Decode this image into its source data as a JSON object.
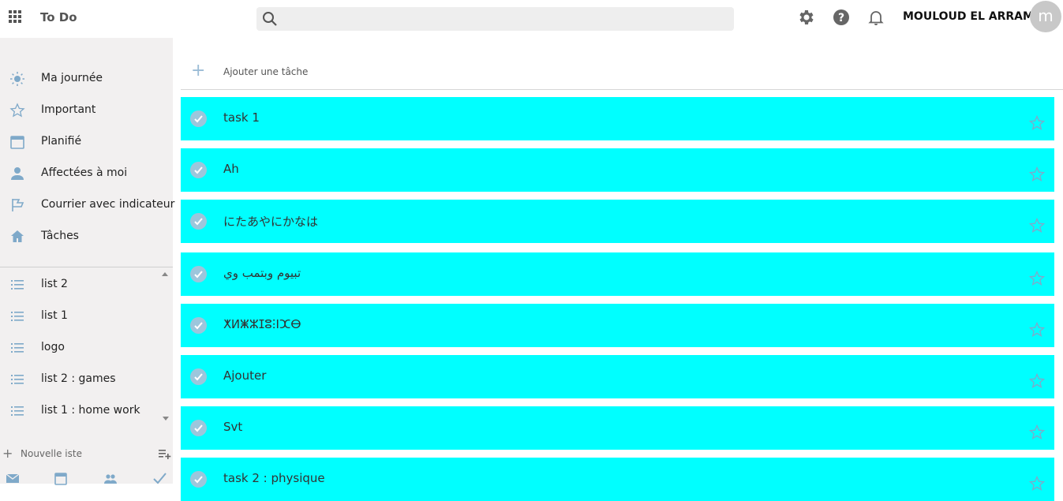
{
  "header": {
    "app_title": "To Do",
    "search_placeholder": "",
    "username": "MOULOUD EL ARRAM",
    "avatar_initial": "m",
    "icons": [
      "waffle-icon",
      "search-icon",
      "gear-icon",
      "help-icon",
      "bell-icon"
    ]
  },
  "sidebar": {
    "nav": [
      {
        "label": "Ma journée",
        "icon": "sun-icon"
      },
      {
        "label": "Important",
        "icon": "star-icon"
      },
      {
        "label": "Planifié",
        "icon": "calendar-icon"
      },
      {
        "label": "Affectées à moi",
        "icon": "person-icon"
      },
      {
        "label": "Courrier avec indicateur",
        "icon": "flag-icon"
      },
      {
        "label": "Tâches",
        "icon": "home-icon"
      }
    ],
    "lists": [
      {
        "label": "list 2",
        "icon": "list-icon"
      },
      {
        "label": "list 1",
        "icon": "list-icon"
      },
      {
        "label": "logo",
        "icon": "list-icon"
      },
      {
        "label": "list 2 : games",
        "icon": "list-icon"
      },
      {
        "label": "list 1 : home work",
        "icon": "list-icon"
      }
    ],
    "new_list_label": "Nouvelle iste",
    "bottom_icons": [
      "mail-icon",
      "calendar-icon",
      "people-icon",
      "checkmark-icon"
    ]
  },
  "main": {
    "add_task_label": "Ajouter une tâche",
    "task_color": "#00ffff",
    "tasks": [
      {
        "title": "task 1"
      },
      {
        "title": "Ah"
      },
      {
        "title": "にたあやにかなは"
      },
      {
        "title": "تبيوم وبتمب وي"
      },
      {
        "title": "ⵅⵍⵥⵣⵊⵓⵗⵏⵋⴱ"
      },
      {
        "title": "Ajouter"
      },
      {
        "title": "Svt"
      },
      {
        "title": "task 2 : physique"
      }
    ]
  }
}
